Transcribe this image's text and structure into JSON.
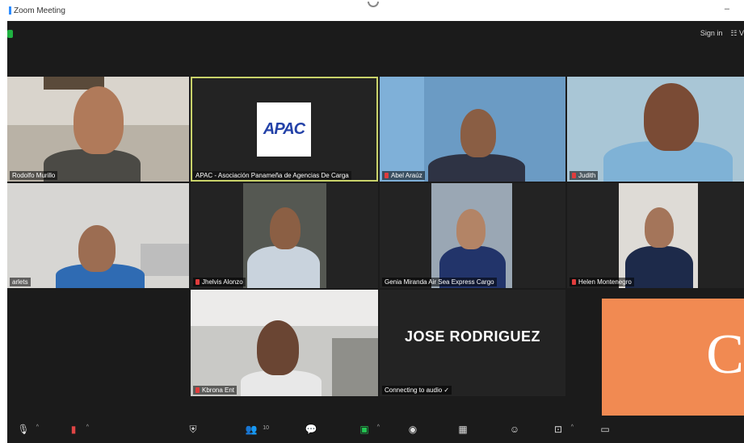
{
  "window": {
    "title": "Zoom Meeting"
  },
  "topright": {
    "sign_in": "Sign in",
    "view": "☷ V"
  },
  "tiles": [
    {
      "name": "Rodolfo Murillo",
      "muted": false
    },
    {
      "name": "APAC - Asociación Panameña de Agencias De Carga",
      "muted": false,
      "logo_text": "APAC",
      "active": true
    },
    {
      "name": "Abel Araúz",
      "muted": true
    },
    {
      "name": "Judith",
      "muted": true
    },
    {
      "name": "arlets",
      "muted": false
    },
    {
      "name": "Jhelvis Alonzo",
      "muted": true
    },
    {
      "name": "Genia Miranda Air Sea Express Cargo",
      "muted": false
    },
    {
      "name": "Helen Montenegro",
      "muted": true
    },
    {
      "name": "Kbrona Ent",
      "muted": true
    },
    {
      "name": "Connecting to audio ✓",
      "display_name": "JOSE RODRIGUEZ",
      "muted": false
    }
  ],
  "overlay": {
    "glyph": "C",
    "color": "#f18a52"
  },
  "toolbar": {
    "items": [
      "mic-icon",
      "video-off-icon",
      "security-icon",
      "participants-icon",
      "chat-icon",
      "share-screen-icon",
      "record-icon",
      "breakout-rooms-icon",
      "reactions-icon",
      "apps-icon",
      "whiteboard-icon"
    ],
    "participants_count": "10"
  },
  "colors": {
    "active_border": "#c9d26a",
    "share_green": "#23c552",
    "muted_red": "#e03c3c"
  }
}
